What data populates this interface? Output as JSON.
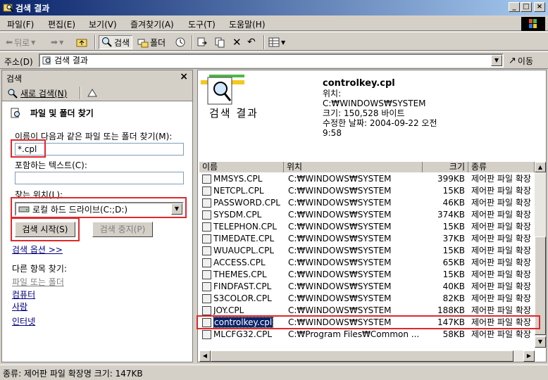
{
  "window": {
    "title": "검색 결과"
  },
  "menu": [
    "파일(F)",
    "편집(E)",
    "보기(V)",
    "즐겨찾기(A)",
    "도구(T)",
    "도움말(H)"
  ],
  "toolbar": {
    "back": "뒤로",
    "search": "검색",
    "folders": "폴더"
  },
  "address": {
    "label": "주소(D)",
    "value": "검색 결과",
    "go": "이동"
  },
  "left_pane": {
    "header": "검색",
    "new_search": "새로 검색(N)",
    "heading": "파일 및 폴더 찾기",
    "name_label": "이름이 다음과 같은 파일 또는 폴더 찾기(M):",
    "name_value": "*.cpl",
    "text_label": "포함하는 텍스트(C):",
    "text_value": "",
    "look_in_label": "찾는 위치(L):",
    "look_in_value": "로컬 하드 드라이브(C:;D:)",
    "search_now": "검색 시작(S)",
    "stop_search": "검색 중지(P)",
    "options": "검색 옵션 >>",
    "other_label": "다른 항목 찾기:",
    "other_links": [
      "파일 또는 폴더",
      "컴퓨터",
      "사람"
    ],
    "internet": "인터넷"
  },
  "right_pane": {
    "banner_title": "검색 결과",
    "selected_info": {
      "name": "controlkey.cpl",
      "location_label": "위치:",
      "location": "C:₩WINDOWS₩SYSTEM",
      "size": "크기: 150,528 바이트",
      "modified": "수정한 날짜: 2004-09-22 오전",
      "time": "9:58"
    },
    "columns": [
      "이름",
      "위치",
      "크기",
      "종류"
    ],
    "rows": [
      [
        "MMSYS.CPL",
        "C:₩WINDOWS₩SYSTEM",
        "399KB",
        "제어판 파일 확장"
      ],
      [
        "NETCPL.CPL",
        "C:₩WINDOWS₩SYSTEM",
        "15KB",
        "제어판 파일 확장"
      ],
      [
        "PASSWORD.CPL",
        "C:₩WINDOWS₩SYSTEM",
        "46KB",
        "제어판 파일 확장"
      ],
      [
        "SYSDM.CPL",
        "C:₩WINDOWS₩SYSTEM",
        "374KB",
        "제어판 파일 확장"
      ],
      [
        "TELEPHON.CPL",
        "C:₩WINDOWS₩SYSTEM",
        "15KB",
        "제어판 파일 확장"
      ],
      [
        "TIMEDATE.CPL",
        "C:₩WINDOWS₩SYSTEM",
        "37KB",
        "제어판 파일 확장"
      ],
      [
        "WUAUCPL.CPL",
        "C:₩WINDOWS₩SYSTEM",
        "15KB",
        "제어판 파일 확장"
      ],
      [
        "ACCESS.CPL",
        "C:₩WINDOWS₩SYSTEM",
        "65KB",
        "제어판 파일 확장"
      ],
      [
        "THEMES.CPL",
        "C:₩WINDOWS₩SYSTEM",
        "15KB",
        "제어판 파일 확장"
      ],
      [
        "FINDFAST.CPL",
        "C:₩WINDOWS₩SYSTEM",
        "40KB",
        "제어판 파일 확장"
      ],
      [
        "S3COLOR.CPL",
        "C:₩WINDOWS₩SYSTEM",
        "82KB",
        "제어판 파일 확장"
      ],
      [
        "JOY.CPL",
        "C:₩WINDOWS₩SYSTEM",
        "188KB",
        "제어판 파일 확장"
      ],
      [
        "controlkey.cpl",
        "C:₩WINDOWS₩SYSTEM",
        "147KB",
        "제어판 파일 확장"
      ],
      [
        "MLCFG32.CPL",
        "C:₩Program Files₩Common ...",
        "58KB",
        "제어판 파일 확장"
      ]
    ],
    "selected_index": 12
  },
  "status": {
    "text": "종류: 제어판 파일 확장명 크기: 147KB"
  },
  "colors": {
    "title_start": "#0a246a",
    "title_end": "#a6caf0",
    "highlight": "#e0282b",
    "selection": "#0a246a"
  }
}
